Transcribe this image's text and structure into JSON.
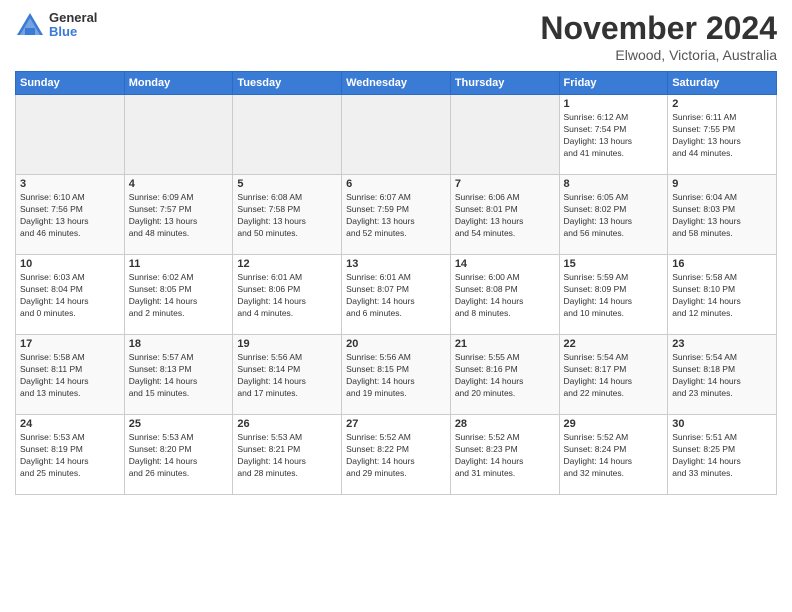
{
  "logo": {
    "general": "General",
    "blue": "Blue"
  },
  "title": "November 2024",
  "location": "Elwood, Victoria, Australia",
  "days_of_week": [
    "Sunday",
    "Monday",
    "Tuesday",
    "Wednesday",
    "Thursday",
    "Friday",
    "Saturday"
  ],
  "weeks": [
    [
      {
        "day": "",
        "info": ""
      },
      {
        "day": "",
        "info": ""
      },
      {
        "day": "",
        "info": ""
      },
      {
        "day": "",
        "info": ""
      },
      {
        "day": "",
        "info": ""
      },
      {
        "day": "1",
        "info": "Sunrise: 6:12 AM\nSunset: 7:54 PM\nDaylight: 13 hours\nand 41 minutes."
      },
      {
        "day": "2",
        "info": "Sunrise: 6:11 AM\nSunset: 7:55 PM\nDaylight: 13 hours\nand 44 minutes."
      }
    ],
    [
      {
        "day": "3",
        "info": "Sunrise: 6:10 AM\nSunset: 7:56 PM\nDaylight: 13 hours\nand 46 minutes."
      },
      {
        "day": "4",
        "info": "Sunrise: 6:09 AM\nSunset: 7:57 PM\nDaylight: 13 hours\nand 48 minutes."
      },
      {
        "day": "5",
        "info": "Sunrise: 6:08 AM\nSunset: 7:58 PM\nDaylight: 13 hours\nand 50 minutes."
      },
      {
        "day": "6",
        "info": "Sunrise: 6:07 AM\nSunset: 7:59 PM\nDaylight: 13 hours\nand 52 minutes."
      },
      {
        "day": "7",
        "info": "Sunrise: 6:06 AM\nSunset: 8:01 PM\nDaylight: 13 hours\nand 54 minutes."
      },
      {
        "day": "8",
        "info": "Sunrise: 6:05 AM\nSunset: 8:02 PM\nDaylight: 13 hours\nand 56 minutes."
      },
      {
        "day": "9",
        "info": "Sunrise: 6:04 AM\nSunset: 8:03 PM\nDaylight: 13 hours\nand 58 minutes."
      }
    ],
    [
      {
        "day": "10",
        "info": "Sunrise: 6:03 AM\nSunset: 8:04 PM\nDaylight: 14 hours\nand 0 minutes."
      },
      {
        "day": "11",
        "info": "Sunrise: 6:02 AM\nSunset: 8:05 PM\nDaylight: 14 hours\nand 2 minutes."
      },
      {
        "day": "12",
        "info": "Sunrise: 6:01 AM\nSunset: 8:06 PM\nDaylight: 14 hours\nand 4 minutes."
      },
      {
        "day": "13",
        "info": "Sunrise: 6:01 AM\nSunset: 8:07 PM\nDaylight: 14 hours\nand 6 minutes."
      },
      {
        "day": "14",
        "info": "Sunrise: 6:00 AM\nSunset: 8:08 PM\nDaylight: 14 hours\nand 8 minutes."
      },
      {
        "day": "15",
        "info": "Sunrise: 5:59 AM\nSunset: 8:09 PM\nDaylight: 14 hours\nand 10 minutes."
      },
      {
        "day": "16",
        "info": "Sunrise: 5:58 AM\nSunset: 8:10 PM\nDaylight: 14 hours\nand 12 minutes."
      }
    ],
    [
      {
        "day": "17",
        "info": "Sunrise: 5:58 AM\nSunset: 8:11 PM\nDaylight: 14 hours\nand 13 minutes."
      },
      {
        "day": "18",
        "info": "Sunrise: 5:57 AM\nSunset: 8:13 PM\nDaylight: 14 hours\nand 15 minutes."
      },
      {
        "day": "19",
        "info": "Sunrise: 5:56 AM\nSunset: 8:14 PM\nDaylight: 14 hours\nand 17 minutes."
      },
      {
        "day": "20",
        "info": "Sunrise: 5:56 AM\nSunset: 8:15 PM\nDaylight: 14 hours\nand 19 minutes."
      },
      {
        "day": "21",
        "info": "Sunrise: 5:55 AM\nSunset: 8:16 PM\nDaylight: 14 hours\nand 20 minutes."
      },
      {
        "day": "22",
        "info": "Sunrise: 5:54 AM\nSunset: 8:17 PM\nDaylight: 14 hours\nand 22 minutes."
      },
      {
        "day": "23",
        "info": "Sunrise: 5:54 AM\nSunset: 8:18 PM\nDaylight: 14 hours\nand 23 minutes."
      }
    ],
    [
      {
        "day": "24",
        "info": "Sunrise: 5:53 AM\nSunset: 8:19 PM\nDaylight: 14 hours\nand 25 minutes."
      },
      {
        "day": "25",
        "info": "Sunrise: 5:53 AM\nSunset: 8:20 PM\nDaylight: 14 hours\nand 26 minutes."
      },
      {
        "day": "26",
        "info": "Sunrise: 5:53 AM\nSunset: 8:21 PM\nDaylight: 14 hours\nand 28 minutes."
      },
      {
        "day": "27",
        "info": "Sunrise: 5:52 AM\nSunset: 8:22 PM\nDaylight: 14 hours\nand 29 minutes."
      },
      {
        "day": "28",
        "info": "Sunrise: 5:52 AM\nSunset: 8:23 PM\nDaylight: 14 hours\nand 31 minutes."
      },
      {
        "day": "29",
        "info": "Sunrise: 5:52 AM\nSunset: 8:24 PM\nDaylight: 14 hours\nand 32 minutes."
      },
      {
        "day": "30",
        "info": "Sunrise: 5:51 AM\nSunset: 8:25 PM\nDaylight: 14 hours\nand 33 minutes."
      }
    ]
  ]
}
